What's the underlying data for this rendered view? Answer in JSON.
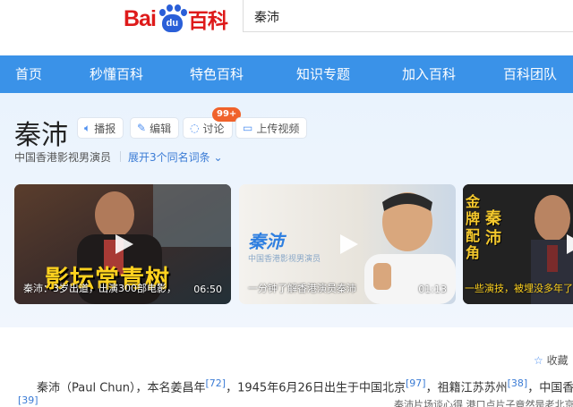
{
  "header": {
    "logo_bai": "Bai",
    "logo_du": "du",
    "logo_baike": "百科",
    "search_value": "秦沛"
  },
  "nav": {
    "items": [
      "首页",
      "秒懂百科",
      "特色百科",
      "知识专题",
      "加入百科",
      "百科团队"
    ]
  },
  "entry": {
    "title": "秦沛",
    "actions": {
      "play": "播报",
      "edit": "编辑",
      "discuss": "讨论",
      "discuss_badge": "99+",
      "upload": "上传视频"
    },
    "subtitle": "中国香港影视男演员",
    "expand": "展开3个同名词条"
  },
  "videos": [
    {
      "overlay": "影坛常青树",
      "caption": "秦沛：3岁出道，出演300部电影，",
      "duration": "06:50"
    },
    {
      "overlay_name": "秦沛",
      "overlay_sub": "中国香港影视男演员",
      "caption": "一分钟了解香港演员秦沛",
      "duration": "01:13"
    },
    {
      "overlay_vertical_1": "金牌配角",
      "overlay_vertical_2": "秦沛",
      "caption": "一些演技，被埋没多年了"
    }
  ],
  "tools": {
    "collect": "收藏"
  },
  "body": {
    "p1_a": "秦沛（Paul Chun），本名姜昌年",
    "p1_cite1": "[72]",
    "p1_b": "，1945年6月26日出生于中国北京",
    "p1_cite2": "[97]",
    "p1_c": "，祖籍江苏苏州",
    "p1_cite3": "[38]",
    "p1_d": "，中国香港影",
    "cite_next": "[39]",
    "peek": "秦沛片场谈心得 港口点片子竟然是老北京"
  },
  "colors": {
    "nav_bg": "#3a92e8",
    "logo_red": "#de1a1a",
    "logo_blue": "#2a5fd8",
    "link": "#3a7bd5",
    "badge": "#f0622b"
  }
}
